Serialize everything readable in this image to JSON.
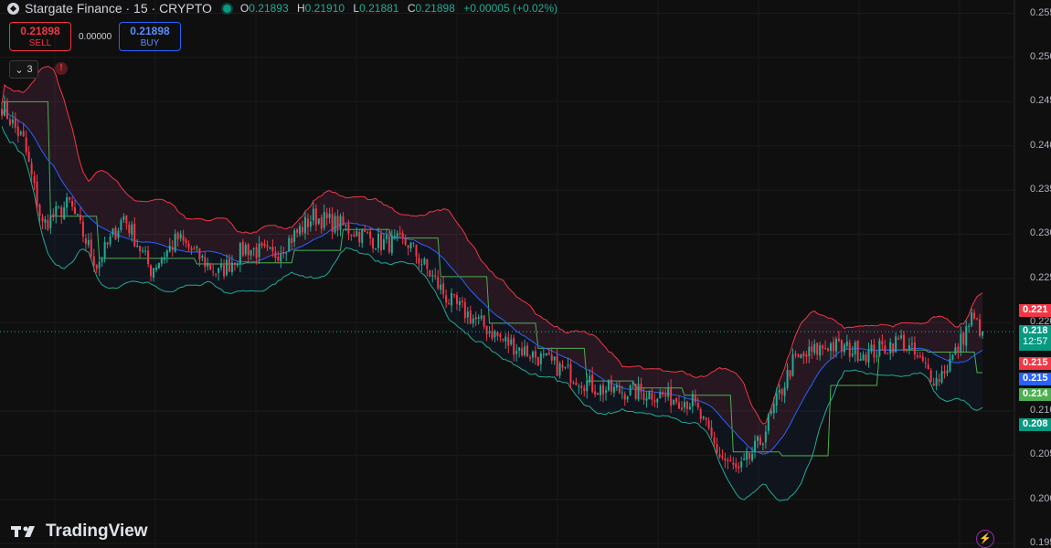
{
  "header": {
    "symbol_title": "Stargate Finance · 15 · CRYPTO",
    "ohlc": [
      {
        "key": "O",
        "value": "0.21893"
      },
      {
        "key": "H",
        "value": "0.21910"
      },
      {
        "key": "L",
        "value": "0.21881"
      },
      {
        "key": "C",
        "value": "0.21898"
      },
      {
        "key": "",
        "value": "+0.00005 (+0.02%)"
      }
    ]
  },
  "trade": {
    "sell_price": "0.21898",
    "sell_label": "SELL",
    "spread": "0.00000",
    "buy_price": "0.21898",
    "buy_label": "BUY"
  },
  "indicators": {
    "collapsed_count": "3",
    "alert_symbol": "!"
  },
  "brand": {
    "logo_text": "TradingView"
  },
  "price_axis": {
    "ticks": [
      "0.255",
      "0.250",
      "0.245",
      "0.240",
      "0.235",
      "0.230",
      "0.225",
      "0.220",
      "0.210",
      "0.205",
      "0.200",
      "0.195"
    ]
  },
  "price_tags": [
    {
      "text": "0.221",
      "color": "#f23645",
      "value": 0.2214
    },
    {
      "text": "0.218",
      "sub": "12:57",
      "color": "#089981",
      "value": 0.21898
    },
    {
      "text": "0.215",
      "color": "#f23645",
      "value": 0.2154
    },
    {
      "text": "0.215",
      "color": "#2962ff",
      "value": 0.2152
    },
    {
      "text": "0.214",
      "color": "#4caf50",
      "value": 0.2143
    },
    {
      "text": "0.208",
      "color": "#089981",
      "value": 0.2085
    }
  ],
  "colors": {
    "up": "#22ab94",
    "down": "#f23645",
    "basis": "#2962ff",
    "upper": "#f23645",
    "lower": "#22ab94",
    "support": "#4caf50"
  },
  "chart_data": {
    "type": "line",
    "ylim": [
      0.1945,
      0.2565
    ],
    "ylabel": "",
    "key_points": [
      {
        "bar": 0,
        "close": 0.2445
      },
      {
        "bar": 8,
        "close": 0.2405
      },
      {
        "bar": 15,
        "close": 0.231
      },
      {
        "bar": 25,
        "close": 0.2335
      },
      {
        "bar": 35,
        "close": 0.2265
      },
      {
        "bar": 45,
        "close": 0.232
      },
      {
        "bar": 55,
        "close": 0.226
      },
      {
        "bar": 65,
        "close": 0.2295
      },
      {
        "bar": 80,
        "close": 0.2255
      },
      {
        "bar": 90,
        "close": 0.2285
      },
      {
        "bar": 100,
        "close": 0.2275
      },
      {
        "bar": 115,
        "close": 0.232
      },
      {
        "bar": 125,
        "close": 0.231
      },
      {
        "bar": 140,
        "close": 0.229
      },
      {
        "bar": 150,
        "close": 0.229
      },
      {
        "bar": 165,
        "close": 0.2225
      },
      {
        "bar": 185,
        "close": 0.218
      },
      {
        "bar": 205,
        "close": 0.215
      },
      {
        "bar": 220,
        "close": 0.2125
      },
      {
        "bar": 240,
        "close": 0.212
      },
      {
        "bar": 255,
        "close": 0.211
      },
      {
        "bar": 265,
        "close": 0.205
      },
      {
        "bar": 272,
        "close": 0.203
      },
      {
        "bar": 280,
        "close": 0.2065
      },
      {
        "bar": 292,
        "close": 0.2155
      },
      {
        "bar": 305,
        "close": 0.2175
      },
      {
        "bar": 320,
        "close": 0.2165
      },
      {
        "bar": 332,
        "close": 0.218
      },
      {
        "bar": 345,
        "close": 0.2135
      },
      {
        "bar": 352,
        "close": 0.2165
      },
      {
        "bar": 358,
        "close": 0.2205
      },
      {
        "bar": 362,
        "close": 0.219
      }
    ]
  }
}
